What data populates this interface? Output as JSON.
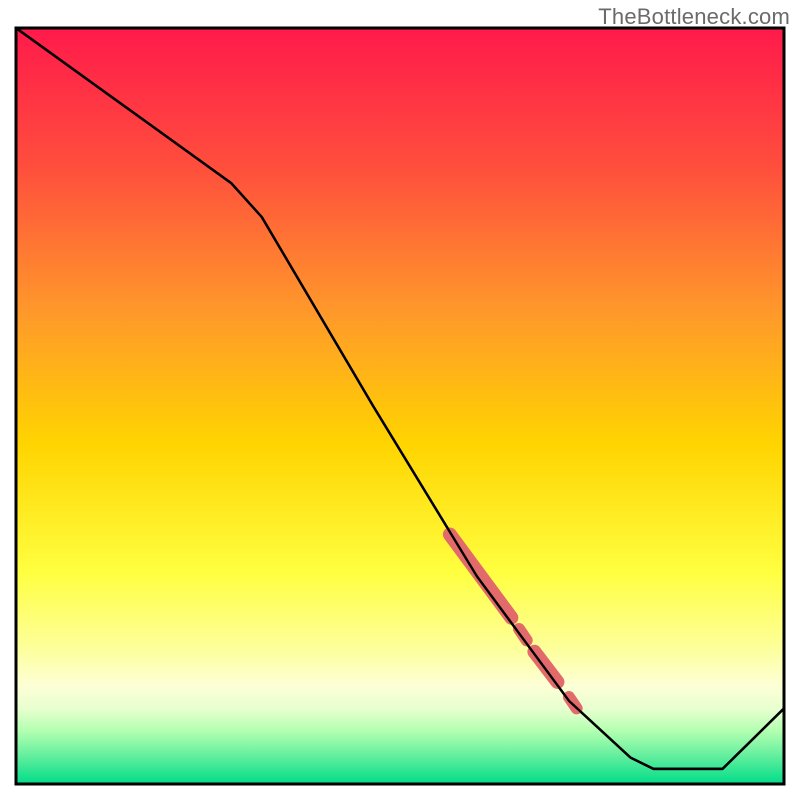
{
  "watermark": "TheBottleneck.com",
  "colors": {
    "gradient_top": "#ff1a4b",
    "gradient_upper_mid": "#ff7a2f",
    "gradient_mid": "#ffd400",
    "gradient_lower_mid": "#ffff66",
    "gradient_light_band": "#fdffd6",
    "gradient_green_band_1": "#c3ffbd",
    "gradient_green_band_2": "#7af290",
    "gradient_bottom": "#00dd88",
    "line": "#000000",
    "highlight": "#e36a6a",
    "border": "#000000"
  },
  "chart_data": {
    "type": "line",
    "title": "",
    "xlabel": "",
    "ylabel": "",
    "xlim": [
      0,
      100
    ],
    "ylim": [
      0,
      100
    ],
    "series": [
      {
        "name": "curve",
        "points": [
          {
            "x": 0,
            "y": 100.0
          },
          {
            "x": 28,
            "y": 79.5
          },
          {
            "x": 32,
            "y": 75.0
          },
          {
            "x": 46.5,
            "y": 50.0
          },
          {
            "x": 60,
            "y": 27.5
          },
          {
            "x": 72,
            "y": 11.0
          },
          {
            "x": 80,
            "y": 3.5
          },
          {
            "x": 83,
            "y": 2.0
          },
          {
            "x": 92,
            "y": 2.0
          },
          {
            "x": 100,
            "y": 10.0
          }
        ]
      }
    ],
    "highlight_segments": [
      {
        "x0": 56.5,
        "y0": 33.0,
        "x1": 64.5,
        "y1": 22.0,
        "kind": "thick"
      },
      {
        "x0": 65.5,
        "y0": 20.5,
        "x1": 66.5,
        "y1": 19.0,
        "kind": "dot"
      },
      {
        "x0": 67.5,
        "y0": 17.5,
        "x1": 70.5,
        "y1": 13.5,
        "kind": "thick"
      },
      {
        "x0": 72.0,
        "y0": 11.5,
        "x1": 73.0,
        "y1": 10.0,
        "kind": "dot"
      }
    ]
  }
}
